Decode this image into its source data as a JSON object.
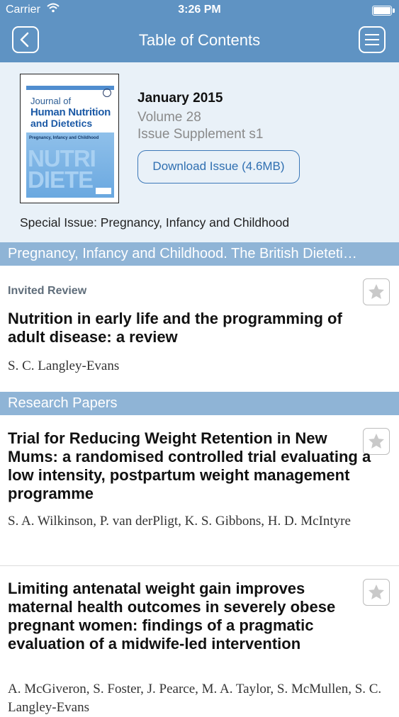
{
  "status_bar": {
    "carrier": "Carrier",
    "time": "3:26 PM"
  },
  "nav": {
    "title": "Table of Contents"
  },
  "issue": {
    "cover": {
      "journal_line1": "Journal of",
      "journal_line2": "Human Nutrition",
      "journal_line3": "and Dietetics",
      "subtitle": "Pregnancy, Infancy and Childhood"
    },
    "date": "January 2015",
    "volume": "Volume 28",
    "supplement": "Issue Supplement s1",
    "download_label": "Download Issue (4.6MB)",
    "special_issue": "Special Issue: Pregnancy, Infancy and Childhood"
  },
  "sections": [
    {
      "header": "Pregnancy, Infancy and Childhood. The British Dieteti…",
      "articles": [
        {
          "label": "Invited Review",
          "title": "Nutrition in early life and the programming of adult disease: a review",
          "authors": "S. C. Langley-Evans"
        }
      ]
    },
    {
      "header": "Research Papers",
      "articles": [
        {
          "title": "Trial for Reducing Weight Retention in New Mums: a randomised controlled trial evaluating a low intensity, postpartum weight management programme",
          "authors": "S. A. Wilkinson, P. van derPligt, K. S. Gibbons, H. D. McIntyre"
        },
        {
          "title": "Limiting antenatal weight gain improves maternal health outcomes in severely obese pregnant women: findings of a pragmatic evaluation of a midwife-led intervention",
          "authors": "A. McGiveron, S. Foster, J. Pearce, M. A. Taylor, S. McMullen, S. C. Langley-Evans"
        }
      ]
    }
  ],
  "icons": {
    "back": "chevron-left-icon",
    "menu": "hamburger-menu-icon",
    "favorite": "star-icon",
    "wifi": "wifi-icon",
    "battery": "battery-icon"
  },
  "colors": {
    "nav_bar": "#5f93c3",
    "section_header": "#8fb4d6",
    "issue_background": "#e9f1f8",
    "accent": "#2f6fb1"
  }
}
